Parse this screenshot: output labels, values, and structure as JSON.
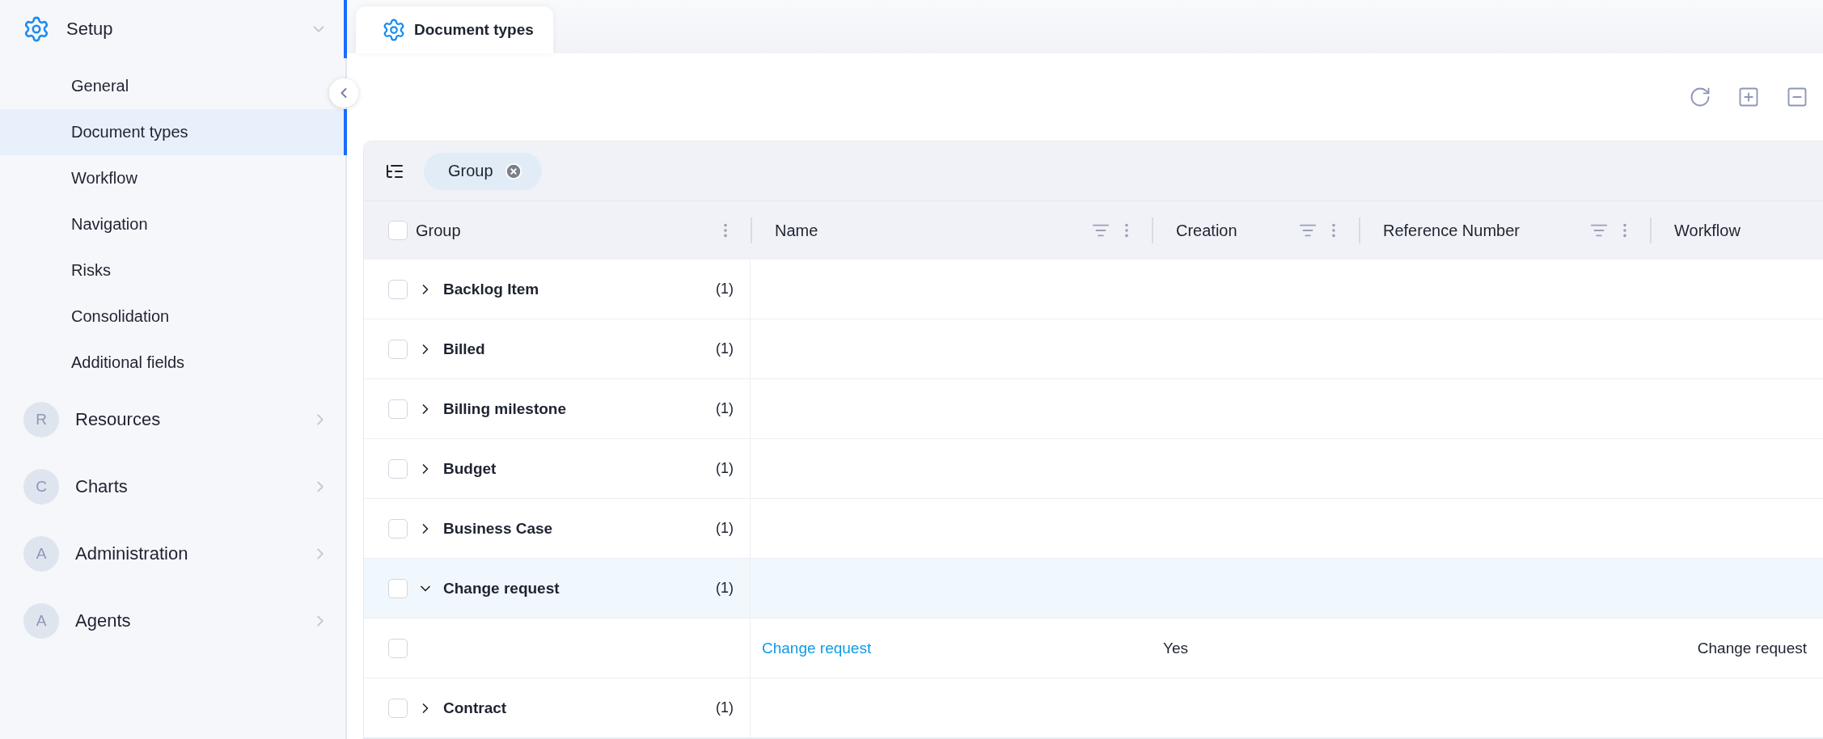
{
  "sidebar": {
    "sections": [
      {
        "label": "Setup",
        "kind": "gear",
        "expanded": true,
        "children": [
          {
            "label": "General",
            "selected": false
          },
          {
            "label": "Document types",
            "selected": true
          },
          {
            "label": "Workflow",
            "selected": false
          },
          {
            "label": "Navigation",
            "selected": false
          },
          {
            "label": "Risks",
            "selected": false
          },
          {
            "label": "Consolidation",
            "selected": false
          },
          {
            "label": "Additional fields",
            "selected": false
          }
        ]
      },
      {
        "label": "Resources",
        "kind": "letter",
        "letter": "R",
        "expanded": false
      },
      {
        "label": "Charts",
        "kind": "letter",
        "letter": "C",
        "expanded": false
      },
      {
        "label": "Administration",
        "kind": "letter",
        "letter": "A",
        "expanded": false
      },
      {
        "label": "Agents",
        "kind": "letter",
        "letter": "A",
        "expanded": false
      }
    ]
  },
  "tabs": [
    {
      "label": "Document types",
      "selected": true
    }
  ],
  "table": {
    "header_checked": false,
    "group_chips": [
      {
        "label": "Group"
      }
    ],
    "columns": [
      {
        "label": "Group",
        "filter": false,
        "menu": true
      },
      {
        "label": "Name",
        "filter": true,
        "menu": true
      },
      {
        "label": "Creation",
        "filter": true,
        "menu": true
      },
      {
        "label": "Reference Number",
        "filter": true,
        "menu": true
      },
      {
        "label": "Workflow",
        "filter": false,
        "menu": false
      }
    ],
    "rows": [
      {
        "kind": "group",
        "label": "Backlog Item",
        "count": "(1)",
        "expanded": false,
        "checked": false
      },
      {
        "kind": "group",
        "label": "Billed",
        "count": "(1)",
        "expanded": false,
        "checked": false
      },
      {
        "kind": "group",
        "label": "Billing milestone",
        "count": "(1)",
        "expanded": false,
        "checked": false
      },
      {
        "kind": "group",
        "label": "Budget",
        "count": "(1)",
        "expanded": false,
        "checked": false
      },
      {
        "kind": "group",
        "label": "Business Case",
        "count": "(1)",
        "expanded": false,
        "checked": false
      },
      {
        "kind": "group",
        "label": "Change request",
        "count": "(1)",
        "expanded": true,
        "checked": false
      },
      {
        "kind": "item",
        "name": "Change request",
        "creation": "Yes",
        "workflow": "Change request",
        "checked": false
      },
      {
        "kind": "group",
        "label": "Contract",
        "count": "(1)",
        "expanded": false,
        "checked": false
      }
    ]
  }
}
